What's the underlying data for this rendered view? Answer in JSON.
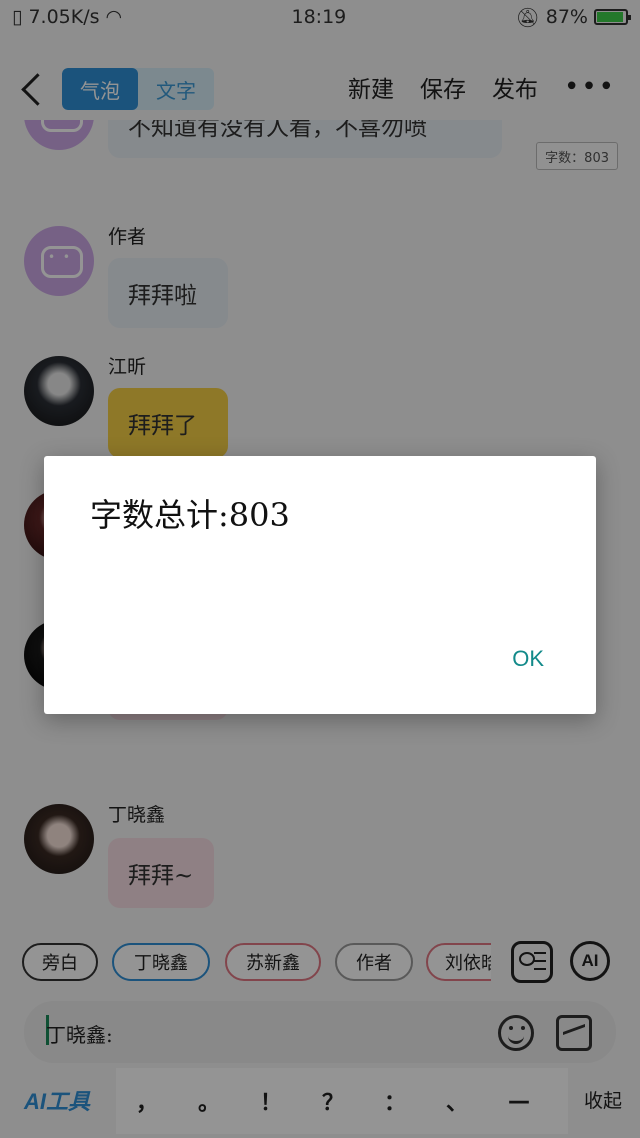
{
  "status_bar": {
    "speed": "7.05K/s",
    "time": "18:19",
    "battery": "87%"
  },
  "header": {
    "tab_bubble": "气泡",
    "tab_text": "文字",
    "new_label": "新建",
    "save_label": "保存",
    "publish_label": "发布",
    "more_label": "•••"
  },
  "chat": {
    "messages": [
      {
        "name": "",
        "text": "不知道有没有人看，不喜勿喷",
        "color": "gray"
      },
      {
        "name": "作者",
        "text": "拜拜啦",
        "color": "gray"
      },
      {
        "name": "江昕",
        "text": "拜拜了",
        "color": "gold"
      },
      {
        "name": "丁晓鑫",
        "text": "拜拜~",
        "color": "pink"
      }
    ],
    "word_count_tag": "字数：803"
  },
  "role_chips": [
    "旁白",
    "丁晓鑫",
    "苏新鑫",
    "作者",
    "刘依晗"
  ],
  "ai_button": "AI",
  "input": {
    "value": "丁晓鑫:"
  },
  "punct": {
    "ai_tools": "AI工具",
    "keys": [
      "，",
      "。",
      "！",
      "？",
      "：",
      "、",
      "—",
      "…"
    ],
    "collapse": "收起"
  },
  "dialog": {
    "message": "字数总计:803",
    "ok": "OK"
  }
}
